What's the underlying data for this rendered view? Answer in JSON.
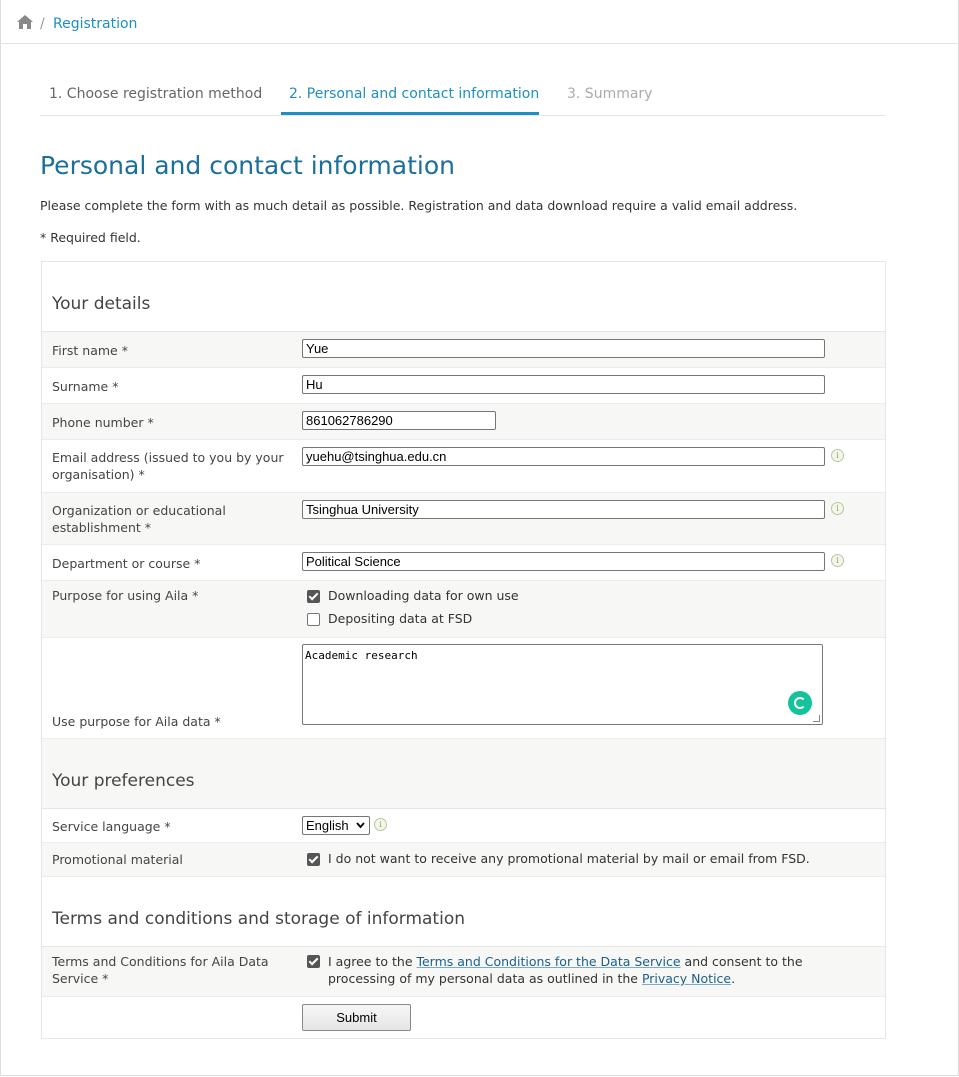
{
  "breadcrumb": {
    "current": "Registration"
  },
  "steps": [
    {
      "label": "1. Choose registration method"
    },
    {
      "label": "2. Personal and contact information"
    },
    {
      "label": "3. Summary"
    }
  ],
  "page": {
    "title": "Personal and contact information",
    "intro": "Please complete the form with as much detail as possible. Registration and data download require a valid email address.",
    "required_note": "* Required field."
  },
  "details": {
    "title": "Your details",
    "first_name": {
      "label": "First name *",
      "value": "Yue"
    },
    "surname": {
      "label": "Surname *",
      "value": "Hu"
    },
    "phone": {
      "label": "Phone number *",
      "value": "861062786290"
    },
    "email": {
      "label": "Email address (issued to you by your organisation) *",
      "value": "yuehu@tsinghua.edu.cn"
    },
    "organization": {
      "label": "Organization or educational establishment *",
      "value": "Tsinghua University"
    },
    "department": {
      "label": "Department or course *",
      "value": "Political Science"
    },
    "purpose": {
      "label": "Purpose for using Aila *",
      "options": [
        {
          "label": "Downloading data for own use",
          "checked": true
        },
        {
          "label": "Depositing data at FSD",
          "checked": false
        }
      ]
    },
    "use_purpose": {
      "label": "Use purpose for Aila data *",
      "value": "Academic research"
    }
  },
  "preferences": {
    "title": "Your preferences",
    "language": {
      "label": "Service language *",
      "value": "English"
    },
    "promo": {
      "label": "Promotional material",
      "text": "I do not want to receive any promotional material by mail or email from FSD.",
      "checked": true
    }
  },
  "terms": {
    "title": "Terms and conditions and storage of information",
    "label": "Terms and Conditions for Aila Data Service *",
    "text_1": "I agree to the ",
    "link_1": "Terms and Conditions for the Data Service",
    "text_2": " and consent to the processing of my personal data as outlined in the ",
    "link_2": "Privacy Notice",
    "text_3": ".",
    "checked": true
  },
  "submit_label": "Submit",
  "icons": {
    "home": "home-icon",
    "info": "info-icon",
    "grammarly": "grammarly-icon"
  },
  "colors": {
    "accent": "#1d8fc4",
    "title": "#1a6f9b",
    "grammarly": "#15c39a"
  }
}
